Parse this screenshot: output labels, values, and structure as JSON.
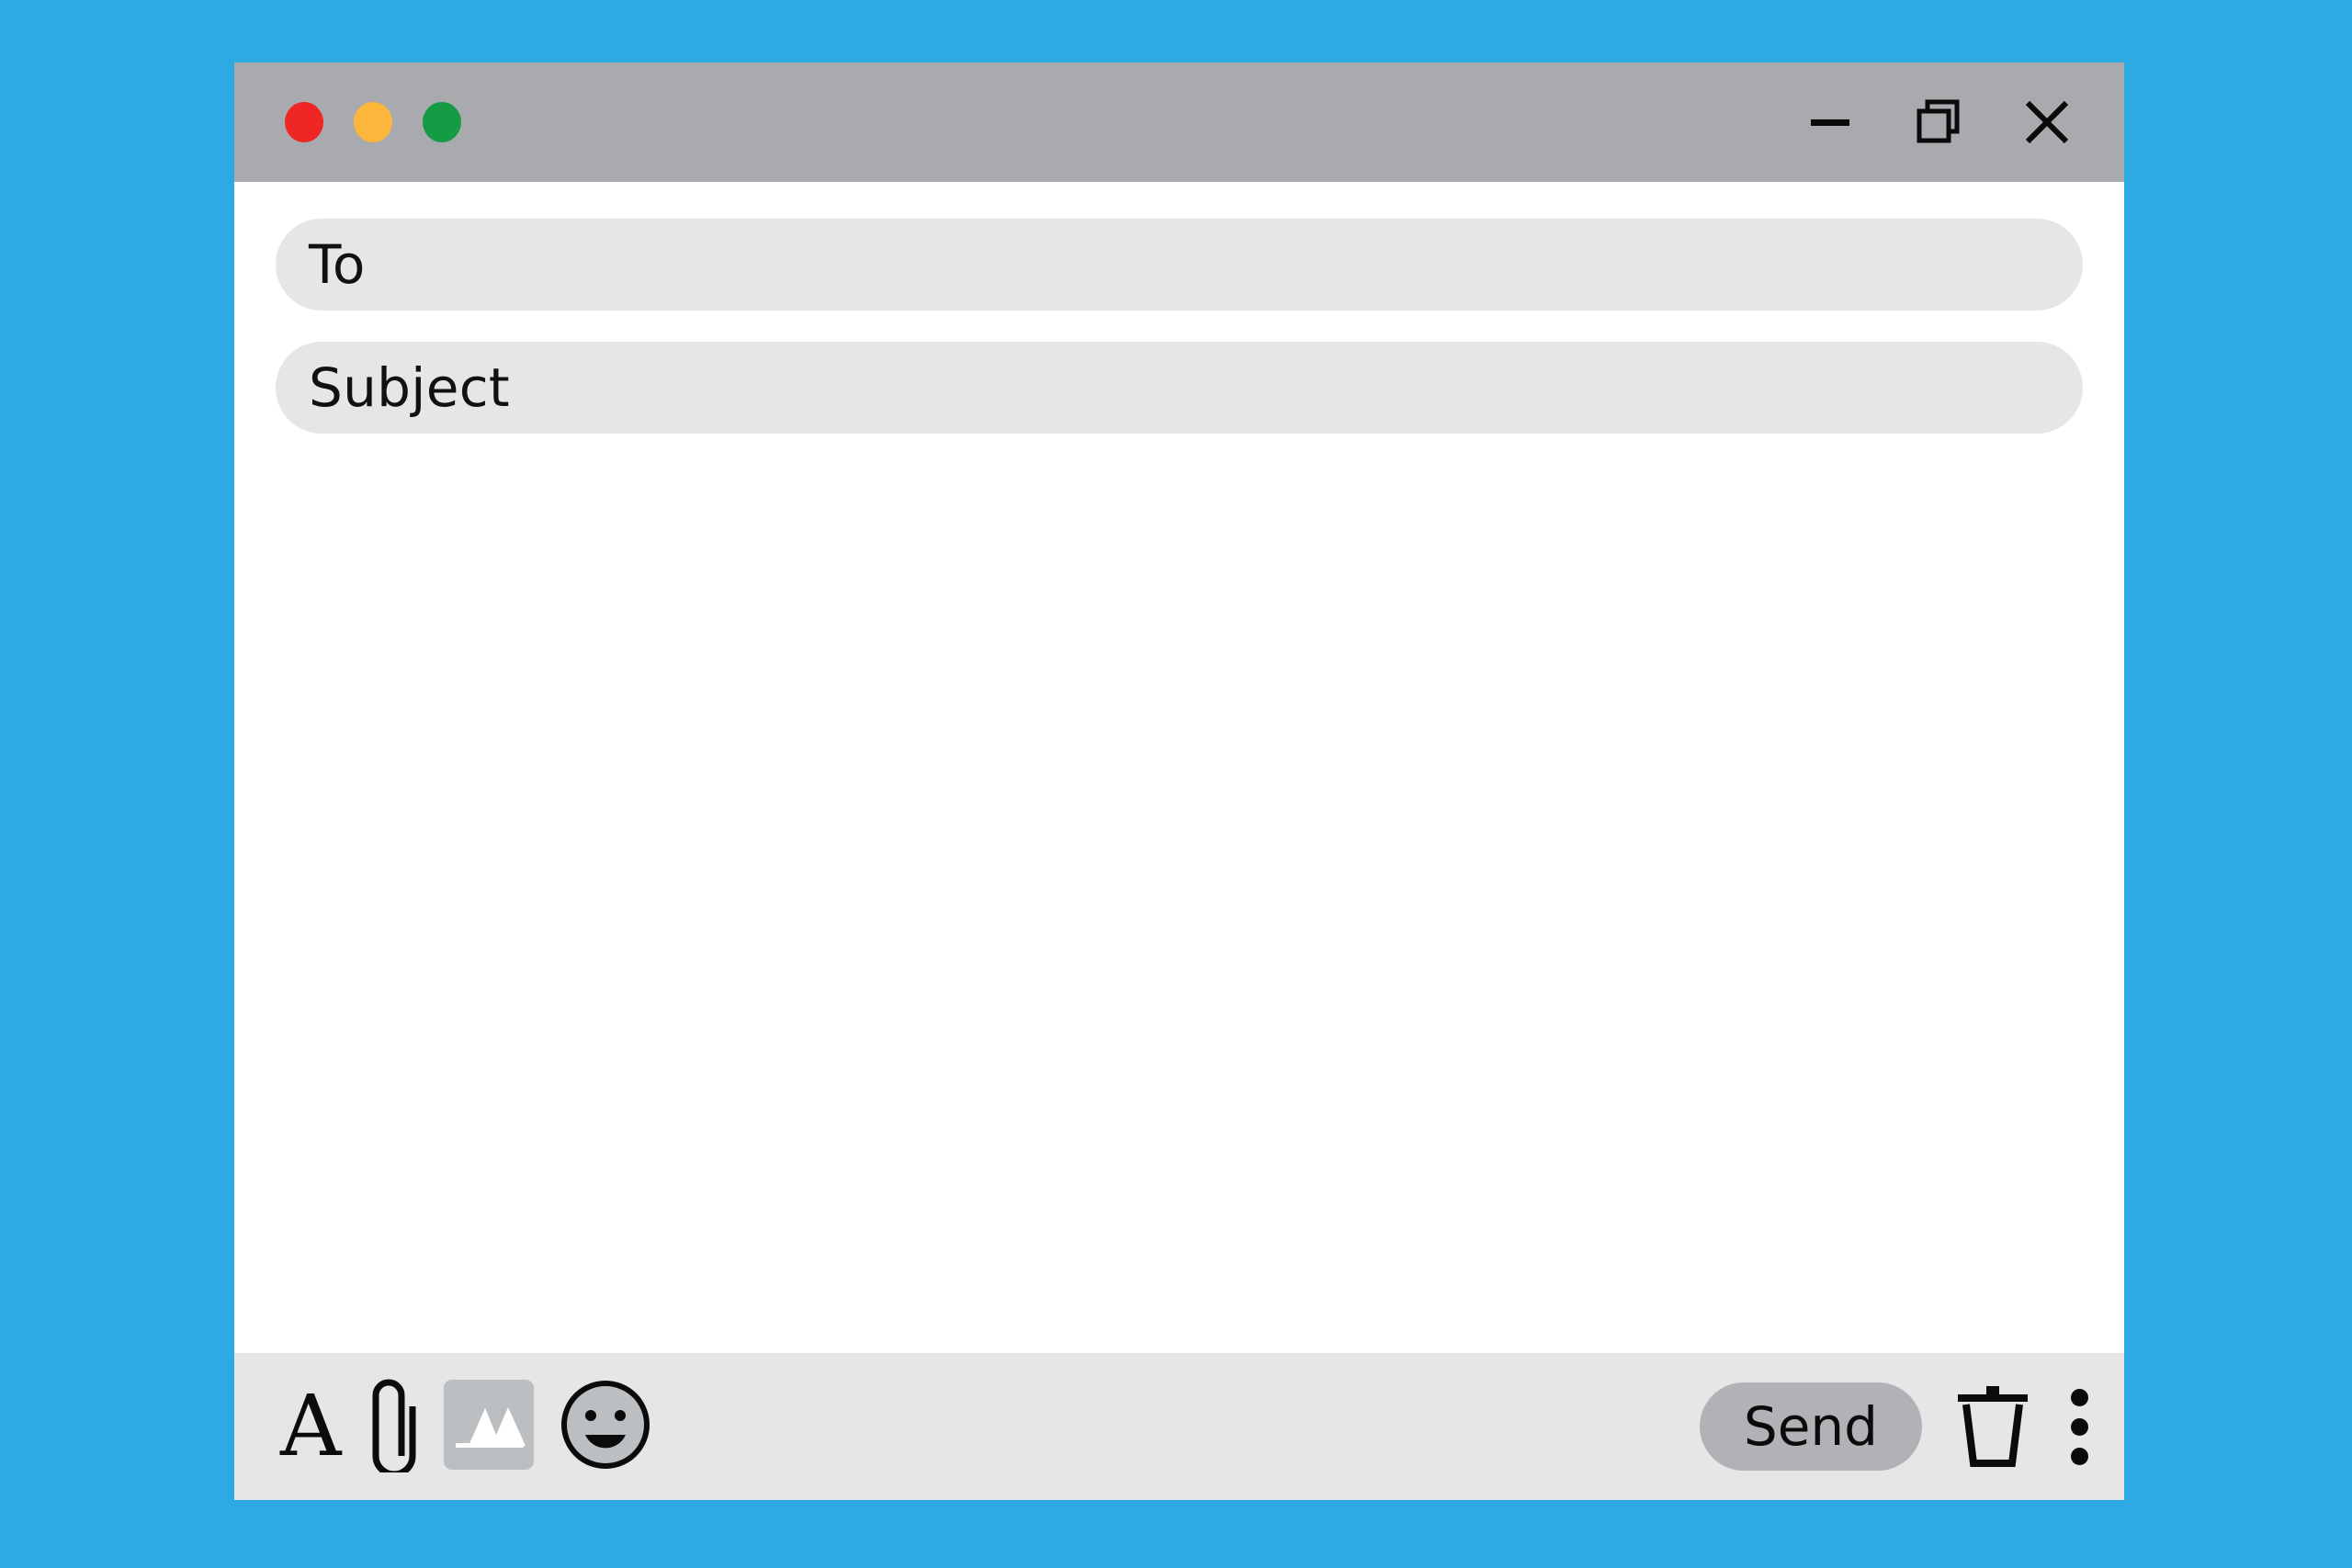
{
  "theme": {
    "background_color": "#2da9e3",
    "window_background": "#ffffff",
    "titlebar_color": "#a9aaae",
    "field_color": "#e6e6e7",
    "toolbar_color": "#e6e6e7",
    "send_button_color": "#b0b2b6",
    "icon_color": "#0b0b0b",
    "traffic_close_color": "#ee2724",
    "traffic_minimize_color": "#fcb63c",
    "traffic_maximize_color": "#159b43"
  },
  "titlebar": {
    "traffic_lights": [
      {
        "name": "close",
        "color": "#ee2724"
      },
      {
        "name": "minimize",
        "color": "#fcb63c"
      },
      {
        "name": "maximize",
        "color": "#159b43"
      }
    ],
    "window_controls": [
      {
        "name": "minimize-icon",
        "label": "Minimize"
      },
      {
        "name": "restore-icon",
        "label": "Restore"
      },
      {
        "name": "close-icon",
        "label": "Close"
      }
    ]
  },
  "compose": {
    "to": {
      "label": "To",
      "value": "",
      "placeholder": "To"
    },
    "subject": {
      "label": "Subject",
      "value": "",
      "placeholder": "Subject"
    },
    "message": {
      "value": "",
      "placeholder": ""
    }
  },
  "toolbar": {
    "left_tools": [
      {
        "name": "text-format-icon",
        "glyph": "A",
        "label": "Text formatting"
      },
      {
        "name": "attachment-icon",
        "label": "Attach file"
      },
      {
        "name": "image-icon",
        "label": "Insert image"
      },
      {
        "name": "emoji-icon",
        "label": "Insert emoji"
      }
    ],
    "send_label": "Send",
    "right_tools": [
      {
        "name": "trash-icon",
        "label": "Discard draft"
      },
      {
        "name": "more-options-icon",
        "label": "More options"
      }
    ]
  }
}
